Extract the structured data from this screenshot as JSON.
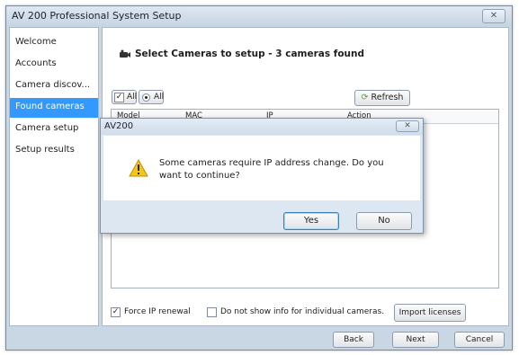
{
  "window": {
    "title": "AV 200 Professional System Setup",
    "close_glyph": "✕"
  },
  "sidebar": {
    "items": [
      {
        "label": "Welcome"
      },
      {
        "label": "Accounts"
      },
      {
        "label": "Camera discov..."
      },
      {
        "label": "Found cameras"
      },
      {
        "label": "Camera setup"
      },
      {
        "label": "Setup results"
      }
    ]
  },
  "main": {
    "header": "Select Cameras to setup - 3 cameras found",
    "select_all_label": "All",
    "select_radio_label": "All",
    "refresh_label": "Refresh",
    "columns": [
      "Model",
      "MAC",
      "IP",
      "Action"
    ],
    "force_ip_label": "Force IP renewal",
    "force_ip_checked": true,
    "no_show_label": "Do not show info for individual cameras.",
    "no_show_checked": false,
    "import_label": "Import licenses"
  },
  "footer": {
    "back": "Back",
    "next": "Next",
    "cancel": "Cancel"
  },
  "dialog": {
    "title": "AV200",
    "message": "Some cameras require IP address change. Do you want to continue?",
    "yes": "Yes",
    "no": "No",
    "close_glyph": "✕"
  },
  "colors": {
    "selection": "#3399ff",
    "chrome": "#c9d6e3"
  },
  "icons": {
    "camera": "camera-icon",
    "warning": "warning-icon",
    "refresh": "refresh-icon"
  }
}
